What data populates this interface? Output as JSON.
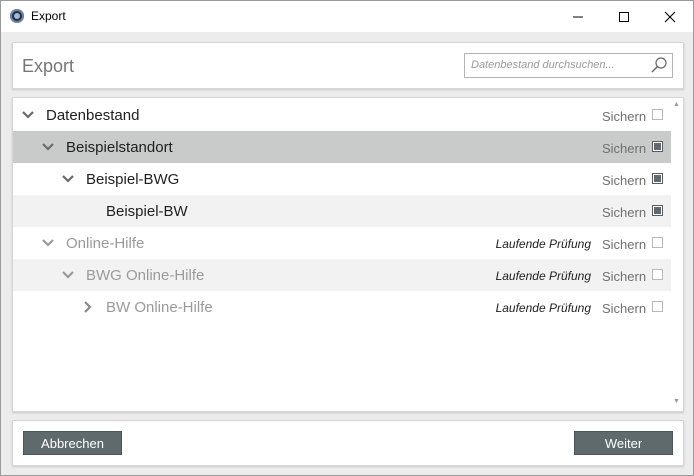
{
  "window": {
    "title": "Export"
  },
  "header": {
    "title": "Export",
    "search_placeholder": "Datenbestand durchsuchen..."
  },
  "tree": {
    "save_label": "Sichern",
    "rows": [
      {
        "label": "Datenbestand",
        "status": "",
        "checked": false
      },
      {
        "label": "Beispielstandort",
        "status": "",
        "checked": true
      },
      {
        "label": "Beispiel-BWG",
        "status": "",
        "checked": true
      },
      {
        "label": "Beispiel-BW",
        "status": "",
        "checked": true
      },
      {
        "label": "Online-Hilfe",
        "status": "Laufende Prüfung",
        "checked": false
      },
      {
        "label": "BWG Online-Hilfe",
        "status": "Laufende Prüfung",
        "checked": false
      },
      {
        "label": "BW Online-Hilfe",
        "status": "Laufende Prüfung",
        "checked": false
      }
    ]
  },
  "footer": {
    "cancel_label": "Abbrechen",
    "next_label": "Weiter"
  }
}
